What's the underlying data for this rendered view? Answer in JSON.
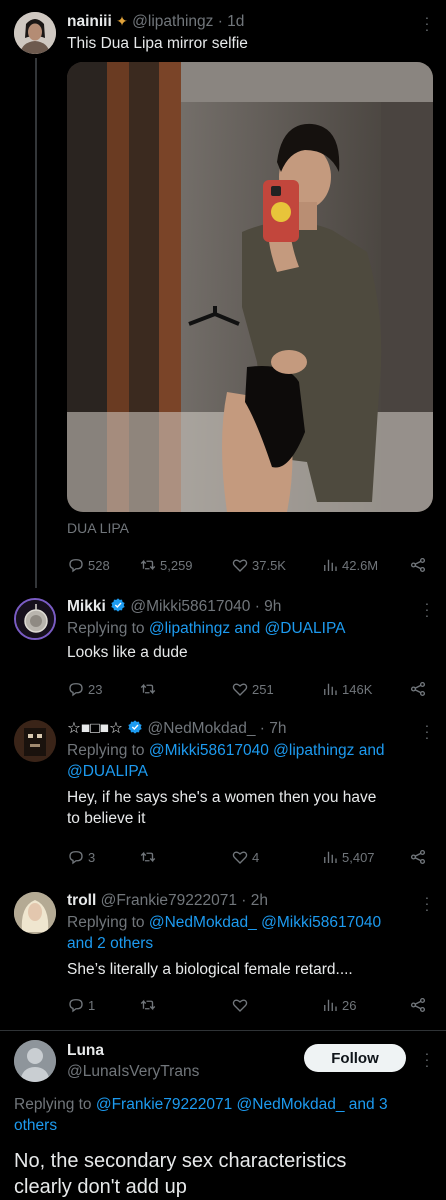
{
  "tweet1": {
    "name": "nainiii",
    "handle": "@lipathingz",
    "time": "· 1d",
    "text": "This Dua Lipa mirror selfie",
    "photo_caption": "DUA LIPA",
    "replies": "528",
    "retweets": "5,259",
    "likes": "37.5K",
    "views": "42.6M"
  },
  "tweet2": {
    "name": "Mikki",
    "handle": "@Mikki58617040",
    "time": "· 9h",
    "replying_prefix": "Replying to",
    "replying_to": "@lipathingz and @DUALIPA",
    "text": "Looks like a dude",
    "replies": "23",
    "retweets": "",
    "likes": "251",
    "views": "146K"
  },
  "tweet3": {
    "name": "☆■□■☆",
    "handle": "@NedMokdad_",
    "time": "· 7h",
    "replying_prefix": "Replying to",
    "replying_line1": "@Mikki58617040 @lipathingz and",
    "replying_line2": "@DUALIPA",
    "text_line1": "Hey, if he says she's a women then you have",
    "text_line2": "to believe it",
    "replies": "3",
    "retweets": "",
    "likes": "4",
    "views": "5,407"
  },
  "tweet4": {
    "name": "troll",
    "handle": "@Frankie79222071",
    "time": "· 2h",
    "replying_prefix": "Replying to",
    "replying_line1": "@NedMokdad_ @Mikki58617040",
    "replying_line2": "and 2 others",
    "text": "She’s literally a biological female retard....",
    "replies": "1",
    "retweets": "",
    "likes": "",
    "views": "26"
  },
  "tweet5": {
    "name": "Luna",
    "handle": "@LunaIsVeryTrans",
    "follow_label": "Follow",
    "replying_prefix": "Replying to",
    "replying_line1": "@Frankie79222071 @NedMokdad_ and 3",
    "replying_line2": "others",
    "text_line1": "No, the secondary sex characteristics",
    "text_line2": "clearly don't add up"
  },
  "colors": {
    "background": "#000000",
    "text": "#e7e9ea",
    "secondary": "#71767b",
    "link": "#1d9bf0",
    "verified": "#1d9bf0"
  }
}
